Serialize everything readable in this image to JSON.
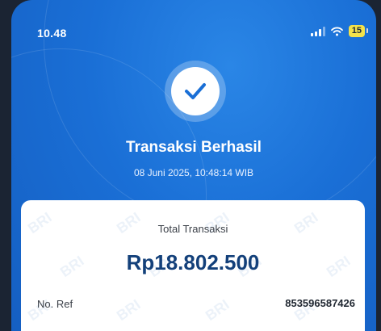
{
  "status_bar": {
    "time": "10.48",
    "battery": "15"
  },
  "receipt": {
    "title": "Transaksi Berhasil",
    "datetime": "08 Juni 2025, 10:48:14 WIB",
    "total_label": "Total Transaksi",
    "total_amount": "Rp18.802.500",
    "ref_label": "No. Ref",
    "ref_value": "853596587426"
  },
  "watermark_text": "BRI",
  "colors": {
    "background_blue": "#1a6fd6",
    "amount_text": "#13407a",
    "check_icon": "#1a6fd6",
    "battery": "#f4e24b"
  },
  "icons": {
    "success": "checkmark-icon",
    "signal": "signal-icon",
    "wifi": "wifi-icon",
    "battery": "battery-icon"
  }
}
